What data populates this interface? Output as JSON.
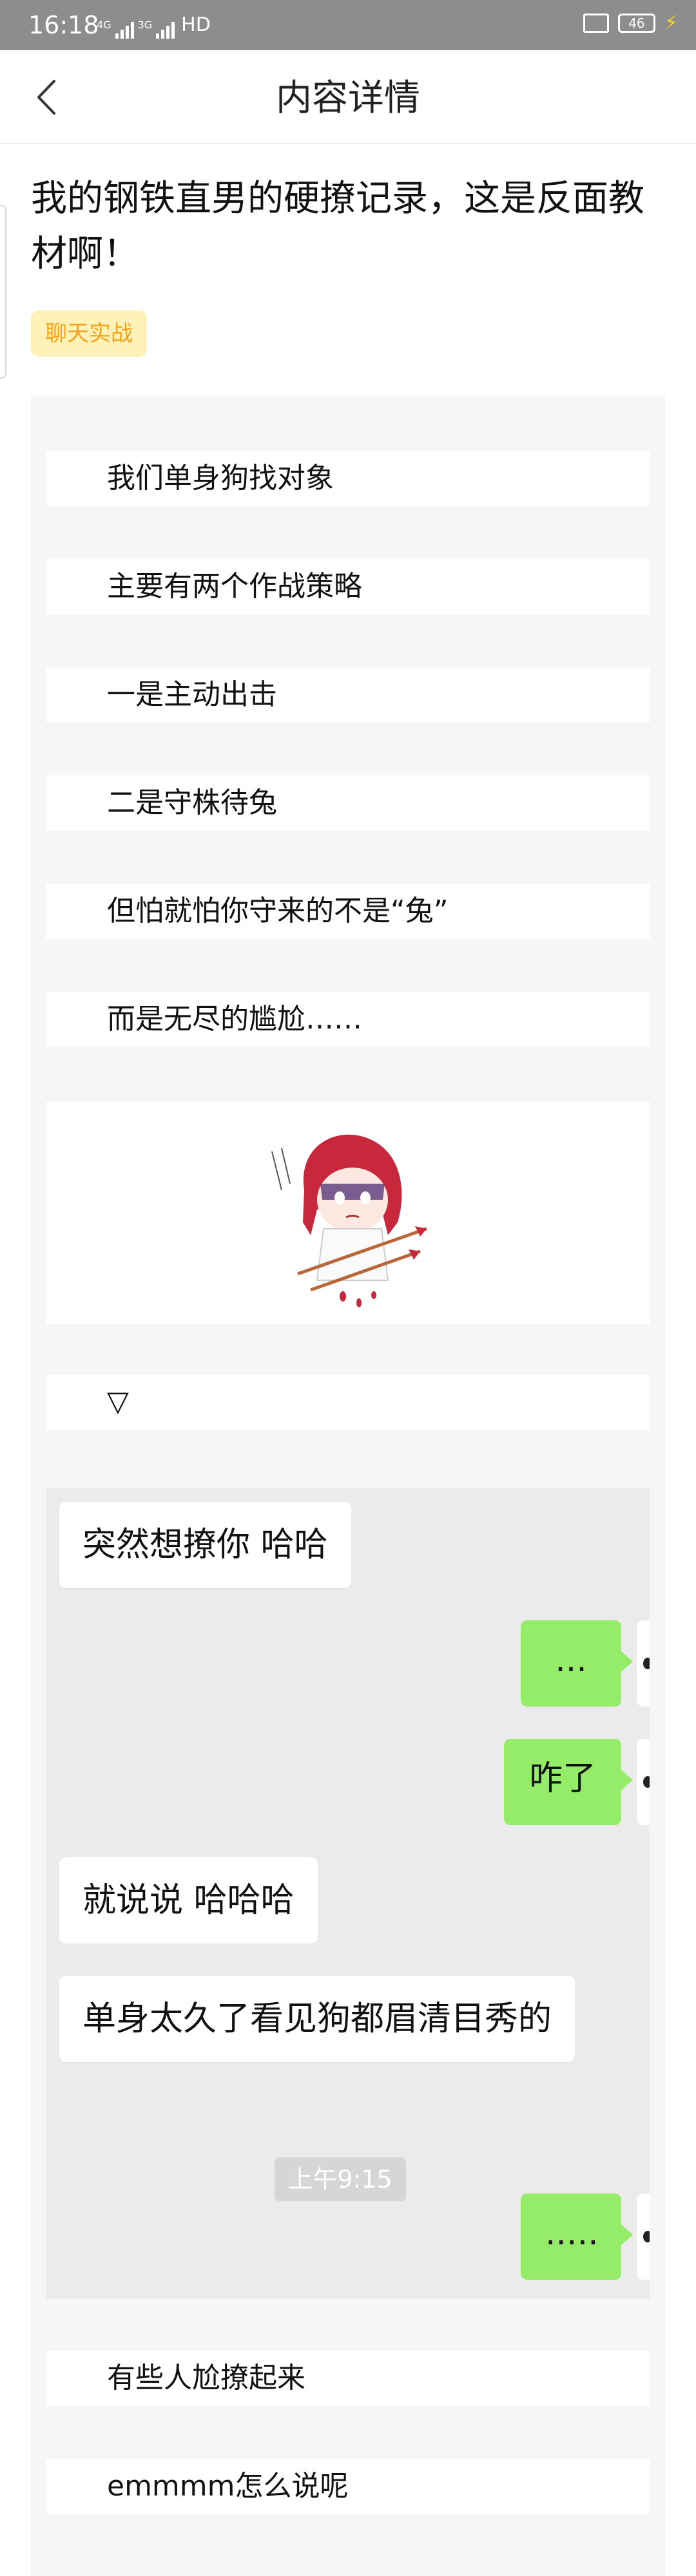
{
  "status_bar": {
    "time": "16:18",
    "net_top": "4G",
    "net_bottom": "3G",
    "hd_label": "HD",
    "battery": "46"
  },
  "header": {
    "title": "内容详情"
  },
  "article": {
    "title": "我的钢铁直男的硬撩记录，这是反面教材啊！",
    "tag": "聊天实战",
    "lines_before_image": [
      "我们单身狗找对象",
      "主要有两个作战策略",
      "一是主动出击",
      "二是守株待兔",
      "但怕就怕你守来的不是“兔”",
      "而是无尽的尴尬……"
    ],
    "marker": "▽",
    "lines_after_chat": [
      "有些人尬撩起来",
      "emmmm怎么说呢"
    ]
  },
  "chat": {
    "messages": [
      {
        "side": "left",
        "text": "突然想撩你  哈哈"
      },
      {
        "side": "right",
        "text": "..."
      },
      {
        "side": "right",
        "text": "咋了"
      },
      {
        "side": "left",
        "text": "就说说  哈哈哈"
      },
      {
        "side": "left",
        "text": "单身太久了看见狗都眉清目秀的"
      },
      {
        "side": "right",
        "text": "....."
      }
    ],
    "timestamp": "上午9:15"
  },
  "colors": {
    "status_bar": "#8d8d8d",
    "tag_bg": "#fff2b8",
    "tag_text": "#f2a31a",
    "chat_bg": "#ebebeb",
    "bubble_right": "#95ec69"
  }
}
